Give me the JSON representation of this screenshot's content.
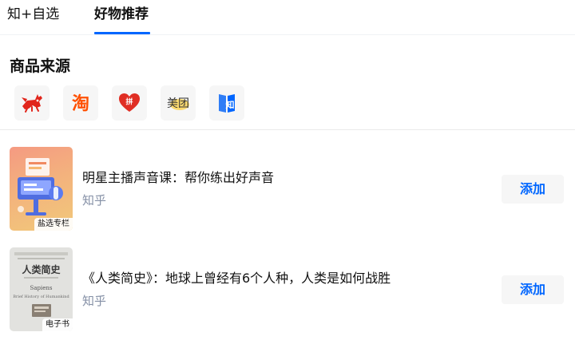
{
  "tabs": [
    {
      "label": "知+自选",
      "active": false
    },
    {
      "label": "好物推荐",
      "active": true
    }
  ],
  "accent_color": "#0066ff",
  "section": {
    "title": "商品来源"
  },
  "sources": [
    {
      "name": "jd-joy-dog-icon",
      "label": "京东"
    },
    {
      "name": "taobao-icon",
      "label": "淘",
      "color": "#ff5000"
    },
    {
      "name": "pinduoduo-icon",
      "label": "拼",
      "color": "#e02e24"
    },
    {
      "name": "meituan-icon",
      "label": "美团",
      "color": "#ffc300"
    },
    {
      "name": "zhihu-icon",
      "label": "知",
      "color": "#0066ff"
    }
  ],
  "items": [
    {
      "title": "明星主播声音课：帮你练出好声音",
      "source": "知乎",
      "tag": "盐选专栏",
      "add_label": "添加"
    },
    {
      "title": "《人类简史》：地球上曾经有6个人种，人类是如何战胜",
      "source": "知乎",
      "tag": "电子书",
      "add_label": "添加",
      "cover": {
        "title": "人类简史",
        "subtitle": "Sapiens",
        "english": "Brief History of Humankind"
      }
    }
  ]
}
